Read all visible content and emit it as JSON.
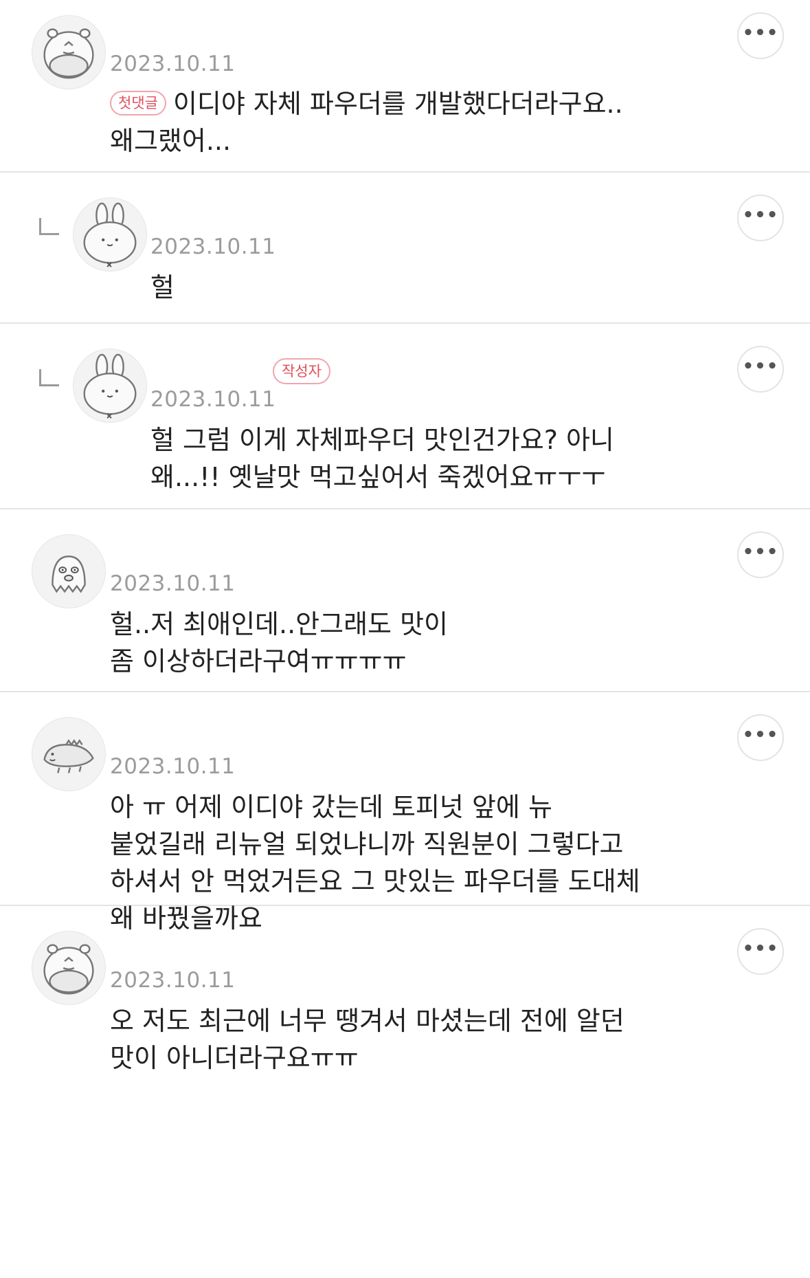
{
  "comments": [
    {
      "date": "2023.10.11",
      "badge": "첫댓글",
      "text": "이디야 자체 파우더를 개발했다더라구요.. 왜그랬어...",
      "avatar": "hippo-avatar-icon",
      "more_icon": "more-options-icon"
    },
    {
      "date": "2023.10.11",
      "text": "헐",
      "avatar": "bunny-avatar-icon",
      "reply_icon": "reply-corner-icon",
      "more_icon": "more-options-icon"
    },
    {
      "date": "2023.10.11",
      "author_badge": "작성자",
      "text": "헐 그럼 이게 자체파우더 맛인건가요? 아니 왜...!! 옛날맛 먹고싶어서 죽겠어요ㅠㅜㅜ",
      "avatar": "bunny-avatar-icon",
      "reply_icon": "reply-corner-icon",
      "more_icon": "more-options-icon"
    },
    {
      "date": "2023.10.11",
      "text_line1": "헐..저 최애인데..안그래도 맛이",
      "text_line2": "좀 이상하더라구여ㅠㅠㅠㅠ",
      "avatar": "ghost-avatar-icon",
      "more_icon": "more-options-icon"
    },
    {
      "date": "2023.10.11",
      "text": "아 ㅠ 어제 이디야 갔는데 토피넛 앞에 뉴 붙었길래 리뉴얼 되었냐니까 직원분이 그렇다고 하셔서 안 먹었거든요 그 맛있는 파우더를 도대체 왜 바꿨을까요",
      "avatar": "dino-avatar-icon",
      "more_icon": "more-options-icon"
    },
    {
      "date": "2023.10.11",
      "text": "오 저도 최근에 너무 땡겨서 마셨는데 전에 알던 맛이 아니더라구요ㅠㅠ",
      "avatar": "hippo-avatar-icon",
      "more_icon": "more-options-icon"
    }
  ],
  "more_label": "•••",
  "colors": {
    "accent": "#e0505c",
    "badge_border": "#f0a5ad",
    "date": "#9b9b9b",
    "divider": "#e4e4e4"
  }
}
